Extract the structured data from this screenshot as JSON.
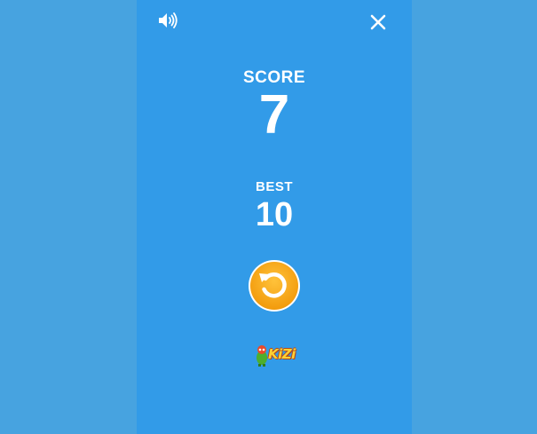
{
  "score": {
    "label": "SCORE",
    "value": "7"
  },
  "best": {
    "label": "BEST",
    "value": "10"
  },
  "logo": {
    "text": "KiZi"
  },
  "icons": {
    "sound": "speaker-icon",
    "close": "close-icon",
    "restart": "restart-icon",
    "logo": "kizi-logo-icon"
  },
  "colors": {
    "background": "#47a3e0",
    "panel": "#329be8",
    "restart_button": "#f5a10e",
    "text": "#ffffff"
  }
}
